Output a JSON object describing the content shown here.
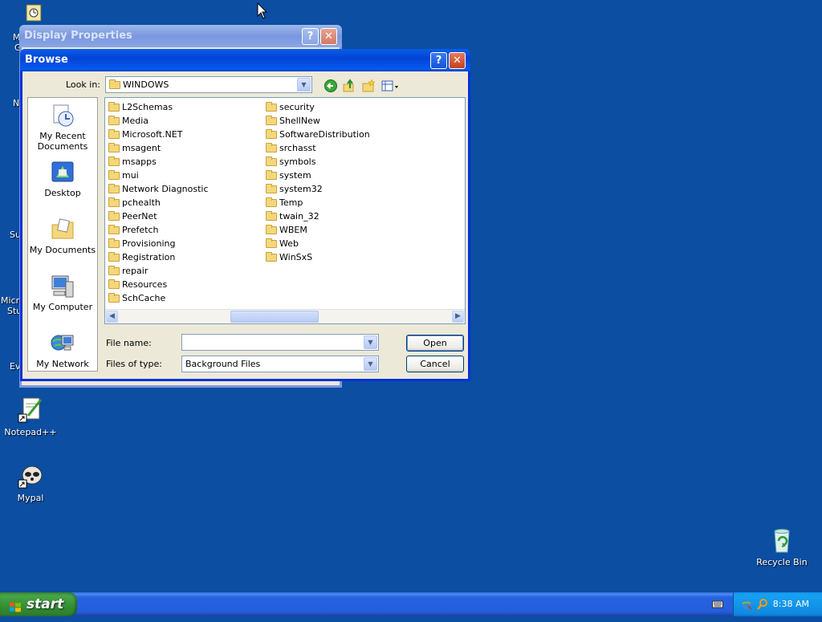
{
  "desktop": {
    "notepad_label": "Notepad++",
    "mypal_label": "Mypal",
    "recycle_label": "Recycle Bin",
    "partial_labels": [
      "M",
      "G",
      "N",
      "Su",
      "Micro",
      "Stu",
      "Ev"
    ]
  },
  "display_properties": {
    "title": "Display Properties",
    "help": "?",
    "close": "✕"
  },
  "browse": {
    "title": "Browse",
    "help": "?",
    "close": "✕",
    "look_in_label": "Look in:",
    "look_in_value": "WINDOWS",
    "places": [
      {
        "label": "My Recent\nDocuments"
      },
      {
        "label": "Desktop"
      },
      {
        "label": "My Documents"
      },
      {
        "label": "My Computer"
      },
      {
        "label": "My Network"
      }
    ],
    "files_col1": [
      "L2Schemas",
      "Media",
      "Microsoft.NET",
      "msagent",
      "msapps",
      "mui",
      "Network Diagnostic",
      "pchealth",
      "PeerNet",
      "Prefetch",
      "Provisioning",
      "Registration",
      "repair",
      "Resources",
      "SchCache"
    ],
    "files_col2": [
      "security",
      "ShellNew",
      "SoftwareDistribution",
      "srchasst",
      "symbols",
      "system",
      "system32",
      "Temp",
      "twain_32",
      "WBEM",
      "Web",
      "WinSxS"
    ],
    "file_name_label": "File name:",
    "file_name_value": "",
    "files_of_type_label": "Files of type:",
    "files_of_type_value": "Background Files",
    "open_label": "Open",
    "cancel_label": "Cancel"
  },
  "taskbar": {
    "start_label": "start",
    "clock": "8:38 AM"
  },
  "icons": {
    "back": "back-arrow-icon",
    "up": "up-folder-icon",
    "new_folder": "new-folder-icon",
    "views": "views-menu-icon"
  }
}
